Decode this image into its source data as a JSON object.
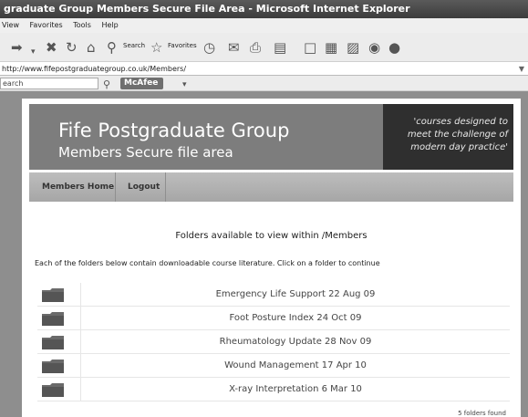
{
  "window": {
    "title": "graduate Group Members Secure File Area - Microsoft Internet Explorer"
  },
  "menu": [
    "View",
    "Favorites",
    "Tools",
    "Help"
  ],
  "toolbar": {
    "search_label": "Search",
    "favorites_label": "Favorites"
  },
  "address": {
    "url": "http://www.fifepostgraduategroup.co.uk/Members/"
  },
  "search_toolbar": {
    "placeholder": "earch",
    "mcafee_label": "McAfee"
  },
  "site": {
    "title": "Fife Postgraduate Group",
    "subtitle": "Members Secure file area",
    "tagline": [
      "'courses designed to",
      "meet the challenge of",
      "modern day practice'"
    ]
  },
  "nav": {
    "home": "Members Home",
    "logout": "Logout"
  },
  "content": {
    "heading": "Folders available to view within /Members",
    "instructions": "Each of the folders below contain downloadable course literature. Click on a folder to continue",
    "folders": [
      "Emergency Life Support 22 Aug 09",
      "Foot Posture Index 24 Oct 09",
      "Rheumatology Update 28 Nov 09",
      "Wound Management 17 Apr 10",
      "X-ray Interpretation 6 Mar 10"
    ],
    "count": "5 folders found"
  }
}
